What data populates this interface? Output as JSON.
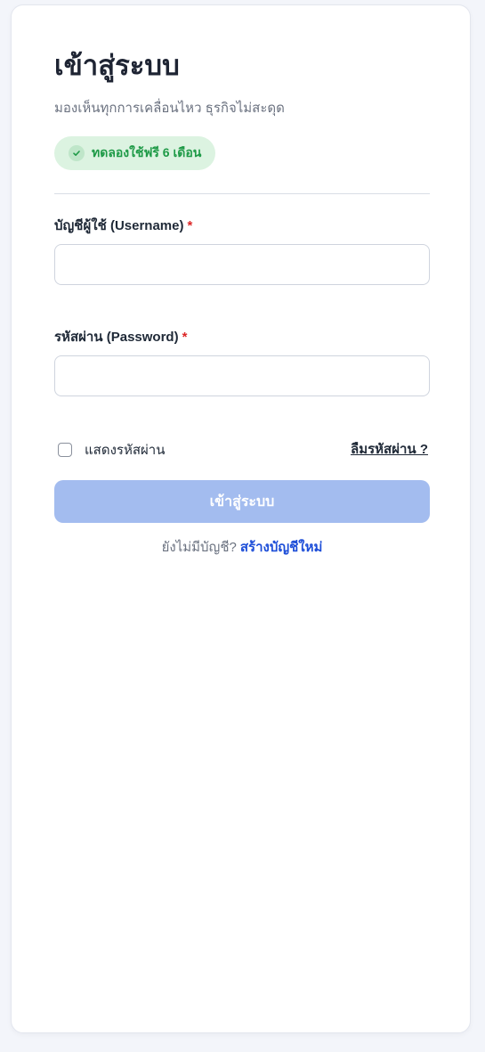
{
  "login": {
    "title": "เข้าสู่ระบบ",
    "subtitle": "มองเห็นทุกการเคลื่อนไหว ธุรกิจไม่สะดุด",
    "badge": "ทดลองใช้ฟรี 6 เดือน"
  },
  "username": {
    "label": "บัญชีผู้ใช้ (Username)",
    "required_mark": "*",
    "value": "",
    "placeholder": ""
  },
  "password": {
    "label": "รหัสผ่าน (Password)",
    "required_mark": "*",
    "value": "",
    "placeholder": ""
  },
  "options": {
    "show_password_label": "แสดงรหัสผ่าน",
    "forgot_password_label": "ลืมรหัสผ่าน ?"
  },
  "submit": {
    "label": "เข้าสู่ระบบ"
  },
  "signup": {
    "prompt": "ยังไม่มีบัญชี?",
    "link": "สร้างบัญชีใหม่"
  },
  "colors": {
    "primary_button": "#a3bcef",
    "badge_bg": "#dcf3e1",
    "badge_text": "#1e9a47",
    "link": "#1d4ed8",
    "required": "#dc2626"
  },
  "icons": {
    "badge_icon": "check-circle-icon"
  }
}
